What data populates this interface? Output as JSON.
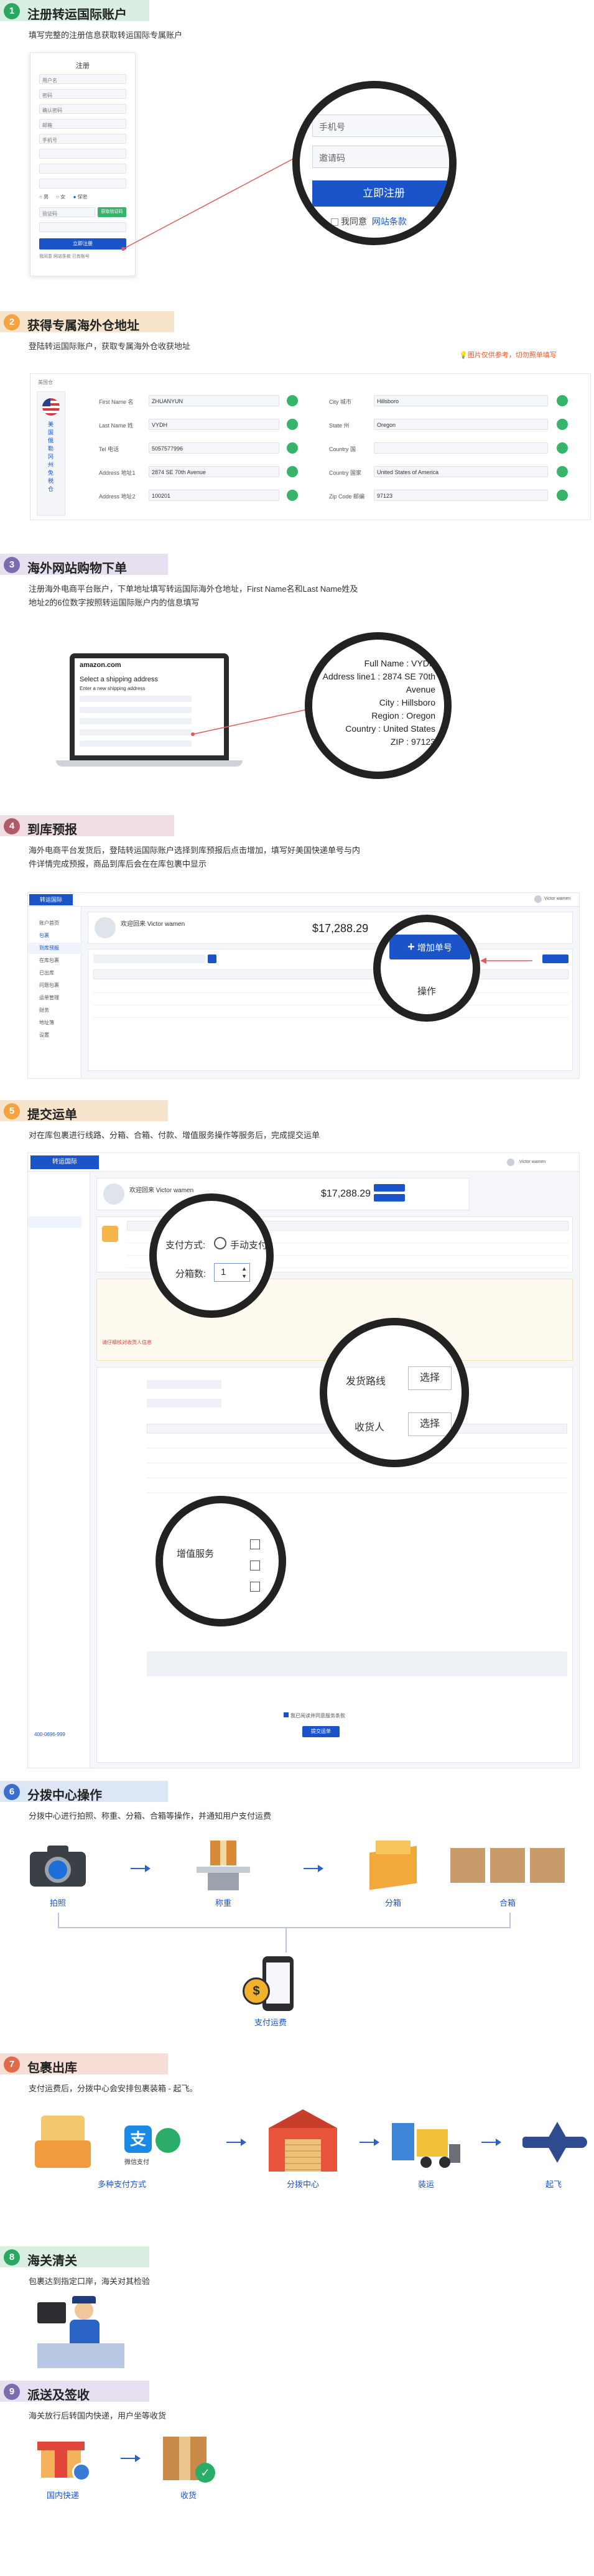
{
  "colors": {
    "green": "#2aa860",
    "orange": "#f4a340",
    "purple": "#7a6cae",
    "blue": "#1a54c8",
    "red": "#e23b3b"
  },
  "steps": [
    {
      "num": "1",
      "title": "注册转运国际账户",
      "desc": "填写完整的注册信息获取转运国际专属账户",
      "color": "#2aa860",
      "band": "#d9efe2"
    },
    {
      "num": "2",
      "title": "获得专属海外仓地址",
      "desc": "登陆转运国际账户，获取专属海外仓收获地址",
      "color": "#f4a340",
      "band": "#f6e4cd"
    },
    {
      "num": "3",
      "title": "海外网站购物下单",
      "desc": "注册海外电商平台账户，下单地址填写转运国际海外仓地址，First Name名和Last Name姓及",
      "desc2": "地址2的6位数字按照转运国际账户内的信息填写",
      "color": "#7a6cae",
      "band": "#e6e0f0"
    },
    {
      "num": "4",
      "title": "到库预报",
      "desc": "海外电商平台发货后，登陆转运国际账户选择到库预报后点击增加，填写好美国快递单号与内",
      "desc2": "件详情完成预报，商品到库后会在在库包裹中显示",
      "color": "#b05a6a",
      "band": "#efdde1"
    },
    {
      "num": "5",
      "title": "提交运单",
      "desc": "对在库包裹进行线路、分箱、合箱、付款、增值服务操作等服务后，完成提交运单",
      "color": "#f4a340",
      "band": "#f6e4cd"
    },
    {
      "num": "6",
      "title": "分拨中心操作",
      "desc": "分拨中心进行拍照、称重、分箱、合箱等操作，并通知用户支付运费",
      "color": "#3a6fcf",
      "band": "#dde6f5"
    },
    {
      "num": "7",
      "title": "包裹出库",
      "desc": "支付运费后，分拨中心会安排包裹装箱 - 起飞。",
      "color": "#e26a4a",
      "band": "#f6ddd5"
    },
    {
      "num": "8",
      "title": "海关清关",
      "desc": "包裹达到指定口岸，海关对其检验",
      "color": "#2aa860",
      "band": "#d9efe2"
    },
    {
      "num": "9",
      "title": "派送及签收",
      "desc": "海关放行后转国内快递，用户坐等收货",
      "color": "#7a6cae",
      "band": "#e6e0f0"
    }
  ],
  "register": {
    "form_title": "注册",
    "fields": [
      "用户名",
      "密码",
      "确认密码",
      "邮箱",
      "手机号",
      "验证码"
    ],
    "captcha_btn": "获取验证码",
    "gender": [
      "男",
      "女",
      "保密"
    ],
    "submit": "立即注册",
    "agree_small": "我同意 网站条款  已有账号",
    "zoom_phone": "手机号",
    "zoom_code": "邀请码",
    "zoom_submit": "立即注册",
    "zoom_agree": "我同意",
    "zoom_terms": "网站条款"
  },
  "address": {
    "note": "图片仅供参考，切勿照单填写",
    "panel_label": "美国仓",
    "side_text": "美国俄勒冈州免税仓",
    "left": [
      {
        "label": "First Name 名",
        "value": "ZHUANYUN"
      },
      {
        "label": "Last Name 姓",
        "value": "VYDH"
      },
      {
        "label": "Tel 电话",
        "value": "5057577996"
      },
      {
        "label": "Address 地址1",
        "value": "2874 SE 70th Avenue"
      },
      {
        "label": "Address 地址2",
        "value": "100201"
      }
    ],
    "right": [
      {
        "label": "City 城市",
        "value": "Hillsboro"
      },
      {
        "label": "State 州",
        "value": "Oregon"
      },
      {
        "label": "Country 国",
        "value": ""
      },
      {
        "label": "Country 国家",
        "value": "United States of America"
      },
      {
        "label": "Zip Code 邮编",
        "value": "97123"
      }
    ]
  },
  "shopping": {
    "site": "amazon.com",
    "heading": "Select a shipping address",
    "sub": "Enter a new shipping address",
    "zoom_lines": [
      "Full Name : VYDH",
      "Address line1 : 2874 SE 70th",
      "Avenue",
      "City : Hillsboro",
      "Region : Oregon",
      "Country : United States",
      "ZIP : 97123"
    ]
  },
  "forecast": {
    "logo": "转运国际",
    "welcome": "欢迎回来",
    "user": "Victor wamen",
    "balance": "$17,288.29",
    "add_btn": "增加单号",
    "op_label": "操作",
    "sidebar": [
      "账户首页",
      "包裹",
      "到库预报",
      "在库包裹",
      "已出库",
      "问题包裹",
      "运单管理",
      "财务",
      "地址簿",
      "设置"
    ]
  },
  "waybill": {
    "logo": "转运国际",
    "welcome": "欢迎回来",
    "user": "Victor wamen",
    "balance": "$17,288.29",
    "pay_label": "支付方式:",
    "pay_option": "手动支付",
    "split_label": "分箱数:",
    "split_value": "1",
    "route_label": "发货路线",
    "route_btn": "选择",
    "recv_label": "收货人",
    "recv_btn": "选择",
    "vas_label": "增值服务",
    "submit": "提交运单",
    "phone": "400-0696-999",
    "warning": "请仔细核对收货人信息",
    "agree": "我已阅读并同意服务条款"
  },
  "center": {
    "items": [
      {
        "name": "camera-icon",
        "label": "拍照"
      },
      {
        "name": "scale-icon",
        "label": "称重"
      },
      {
        "name": "split-box-icon",
        "label": "分箱"
      },
      {
        "name": "merge-box-icon",
        "label": "合箱"
      }
    ],
    "pay_label": "支付运费"
  },
  "outbound": {
    "items": [
      {
        "name": "payment-icon",
        "label": "多种支付方式"
      },
      {
        "name": "warehouse-icon",
        "label": "分拨中心"
      },
      {
        "name": "forklift-icon",
        "label": "装运"
      },
      {
        "name": "plane-icon",
        "label": "起飞"
      }
    ],
    "alipay": "支",
    "wechat": "微信支付"
  },
  "delivery": {
    "items": [
      {
        "name": "courier-icon",
        "label": "国内快递"
      },
      {
        "name": "package-receive-icon",
        "label": "收货"
      }
    ]
  }
}
